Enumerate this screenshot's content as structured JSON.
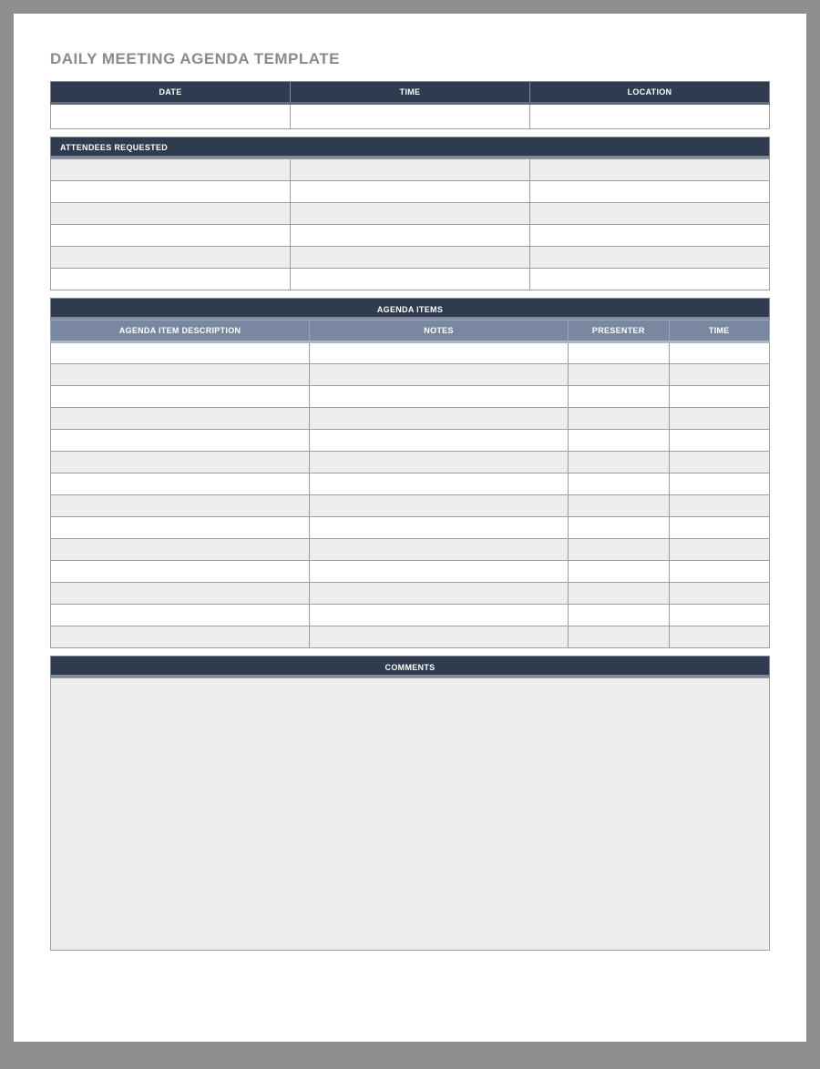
{
  "title": "DAILY MEETING AGENDA TEMPLATE",
  "meta": {
    "headers": {
      "date": "DATE",
      "time": "TIME",
      "location": "LOCATION"
    },
    "values": {
      "date": "",
      "time": "",
      "location": ""
    }
  },
  "attendees": {
    "header": "ATTENDEES REQUESTED",
    "rows": [
      [
        "",
        "",
        ""
      ],
      [
        "",
        "",
        ""
      ],
      [
        "",
        "",
        ""
      ],
      [
        "",
        "",
        ""
      ],
      [
        "",
        "",
        ""
      ],
      [
        "",
        "",
        ""
      ]
    ]
  },
  "agenda": {
    "section_header": "AGENDA ITEMS",
    "columns": {
      "desc": "AGENDA ITEM DESCRIPTION",
      "notes": "NOTES",
      "presenter": "PRESENTER",
      "time": "TIME"
    },
    "rows": [
      [
        "",
        "",
        "",
        ""
      ],
      [
        "",
        "",
        "",
        ""
      ],
      [
        "",
        "",
        "",
        ""
      ],
      [
        "",
        "",
        "",
        ""
      ],
      [
        "",
        "",
        "",
        ""
      ],
      [
        "",
        "",
        "",
        ""
      ],
      [
        "",
        "",
        "",
        ""
      ],
      [
        "",
        "",
        "",
        ""
      ],
      [
        "",
        "",
        "",
        ""
      ],
      [
        "",
        "",
        "",
        ""
      ],
      [
        "",
        "",
        "",
        ""
      ],
      [
        "",
        "",
        "",
        ""
      ],
      [
        "",
        "",
        "",
        ""
      ],
      [
        "",
        "",
        "",
        ""
      ]
    ]
  },
  "comments": {
    "header": "COMMENTS",
    "value": ""
  }
}
